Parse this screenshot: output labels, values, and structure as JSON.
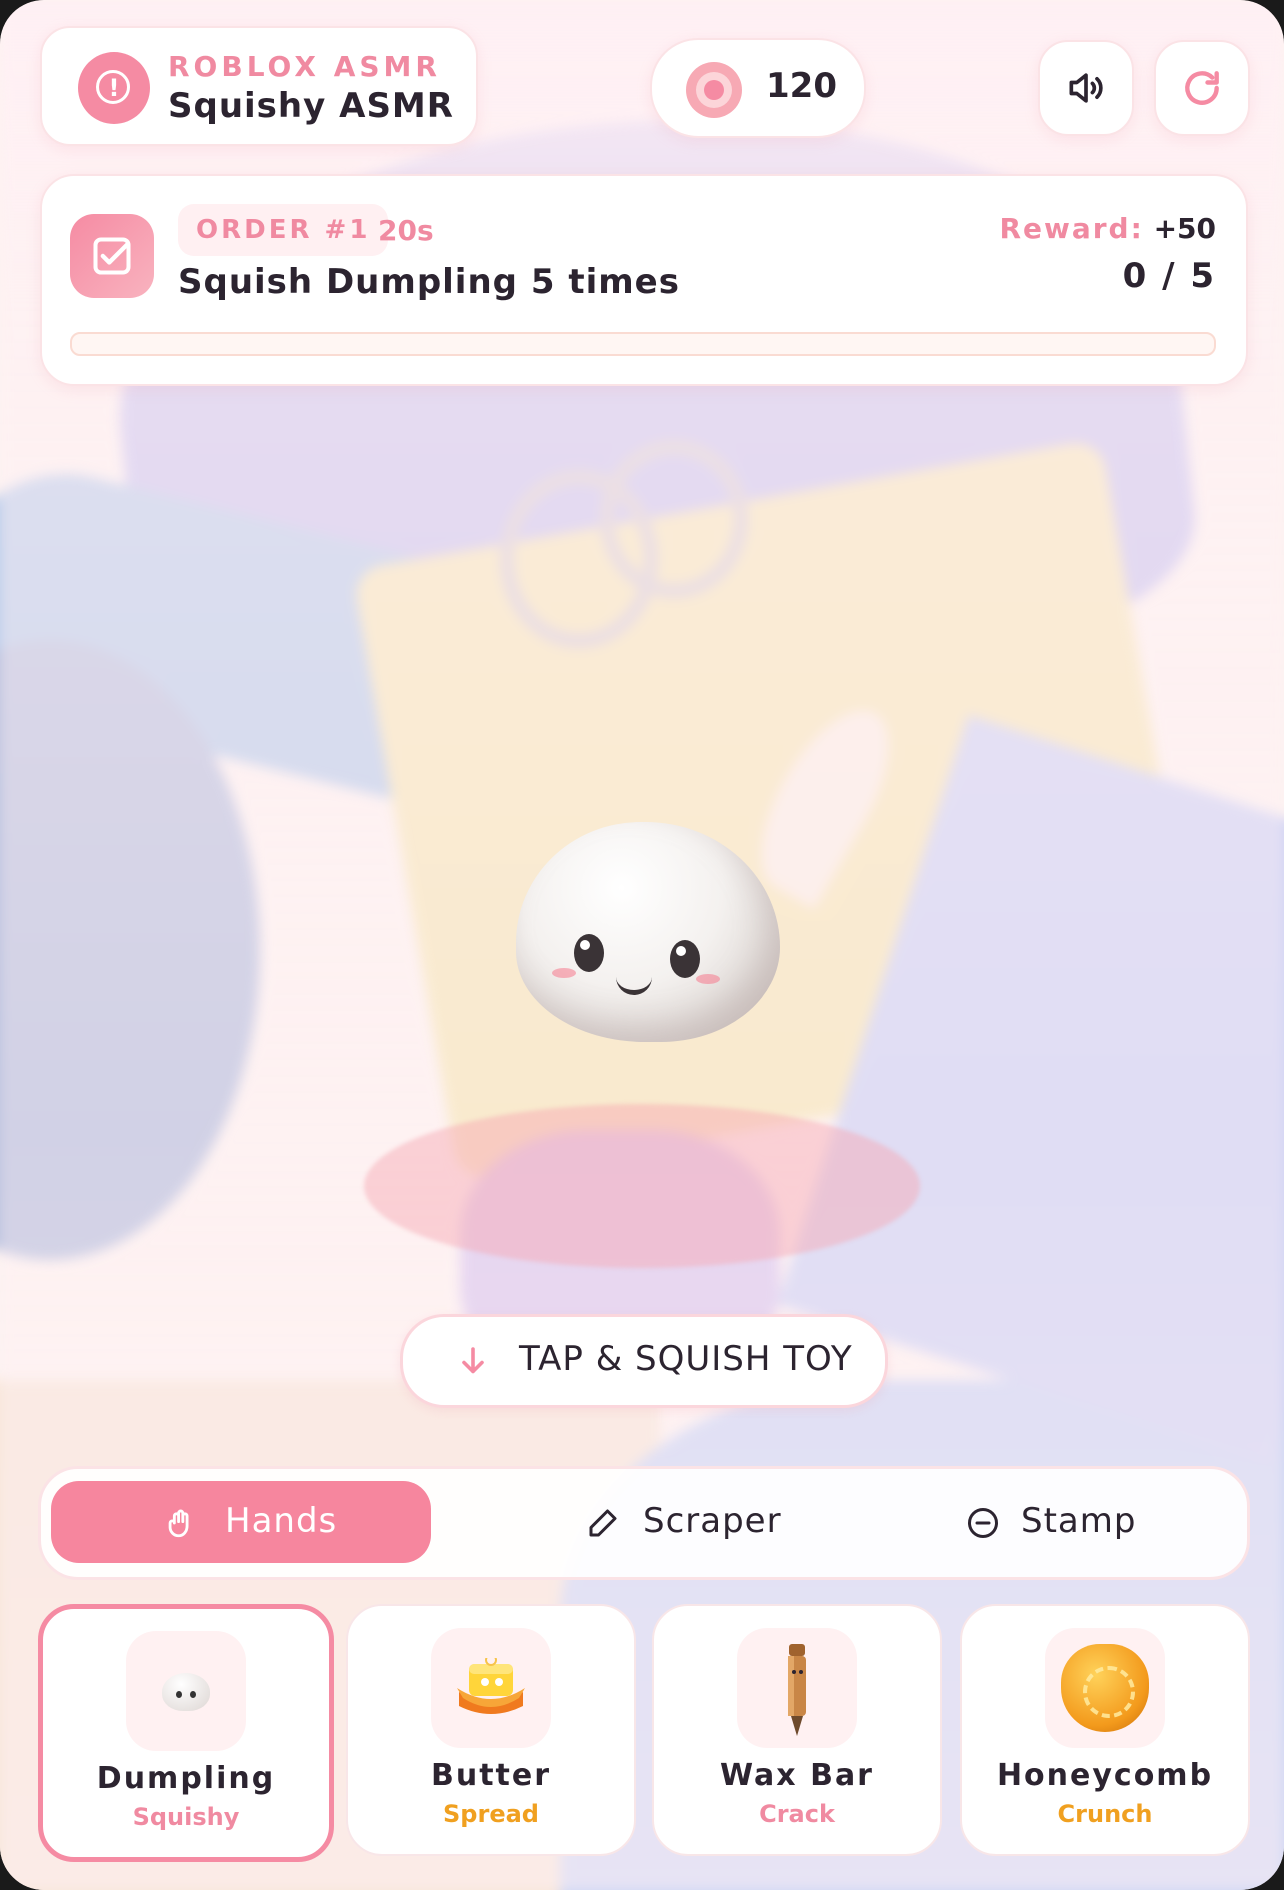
{
  "header": {
    "brand_small": "ROBLOX ASMR",
    "brand_title": "Squishy ASMR",
    "alert_icon": "alert-circle-icon",
    "coins": "120",
    "coin_icon": "coin-icon",
    "sound_icon": "speaker-icon",
    "reset_icon": "refresh-icon"
  },
  "order": {
    "badge": "ORDER #1",
    "timer": "20s",
    "task": "Squish Dumpling 5 times",
    "reward_label": "Reward:",
    "reward_value": "+50",
    "progress_text": "0 / 5",
    "progress_current": 0,
    "progress_target": 5,
    "icon": "checkbox-icon"
  },
  "stage": {
    "current_toy": "Dumpling",
    "tap_label": "TAP & SQUISH TOY",
    "tap_icon": "arrow-down-icon"
  },
  "tools": [
    {
      "label": "Hands",
      "icon": "hand-icon",
      "active": true
    },
    {
      "label": "Scraper",
      "icon": "pencil-icon",
      "active": false
    },
    {
      "label": "Stamp",
      "icon": "minus-circle-icon",
      "active": false
    }
  ],
  "toys": [
    {
      "name": "Dumpling",
      "type": "Squishy",
      "type_color": "#f08aa1",
      "selected": true
    },
    {
      "name": "Butter",
      "type": "Spread",
      "type_color": "#f0a020",
      "selected": false
    },
    {
      "name": "Wax Bar",
      "type": "Crack",
      "type_color": "#f08aa1",
      "selected": false
    },
    {
      "name": "Honeycomb",
      "type": "Crunch",
      "type_color": "#f0a020",
      "selected": false
    }
  ],
  "colors": {
    "accent": "#f58ba3",
    "text": "#2c2430"
  }
}
